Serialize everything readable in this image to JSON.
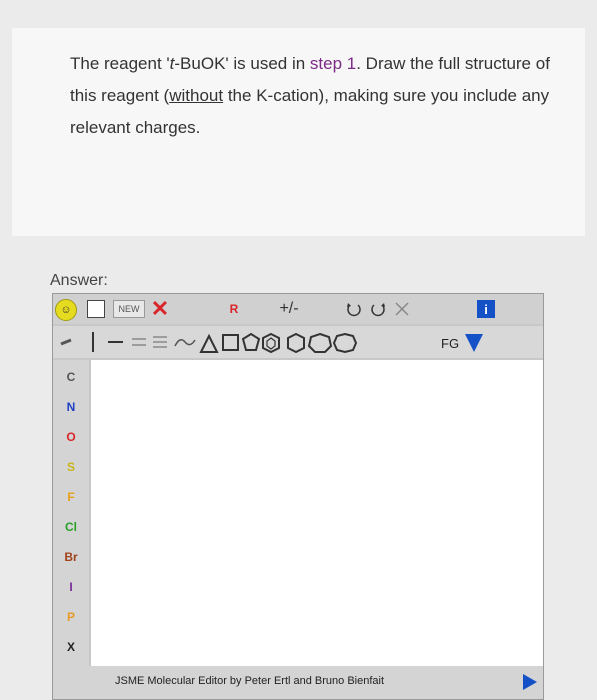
{
  "question": {
    "part1": "The reagent '",
    "tbu": "t",
    "part2": "-BuOK' is used in ",
    "step": "step 1",
    "part3": ". Draw the full structure of this reagent (",
    "without": "without",
    "part4": " the K-cation), making sure you include any relevant charges."
  },
  "answer_label": "Answer:",
  "editor": {
    "new_label": "NEW",
    "r_label": "R",
    "charge_label": "+/-",
    "fg_label": "FG",
    "info_label": "i",
    "elements": [
      "C",
      "N",
      "O",
      "S",
      "F",
      "Cl",
      "Br",
      "I",
      "P",
      "X"
    ],
    "element_colors": [
      "#555555",
      "#1f3fc4",
      "#d9262b",
      "#c9b41a",
      "#e6a01a",
      "#2aa02a",
      "#a0421a",
      "#7a2b9a",
      "#e89a2a",
      "#222222"
    ],
    "footer": "JSME Molecular Editor by Peter Ertl and Bruno Bienfait"
  }
}
